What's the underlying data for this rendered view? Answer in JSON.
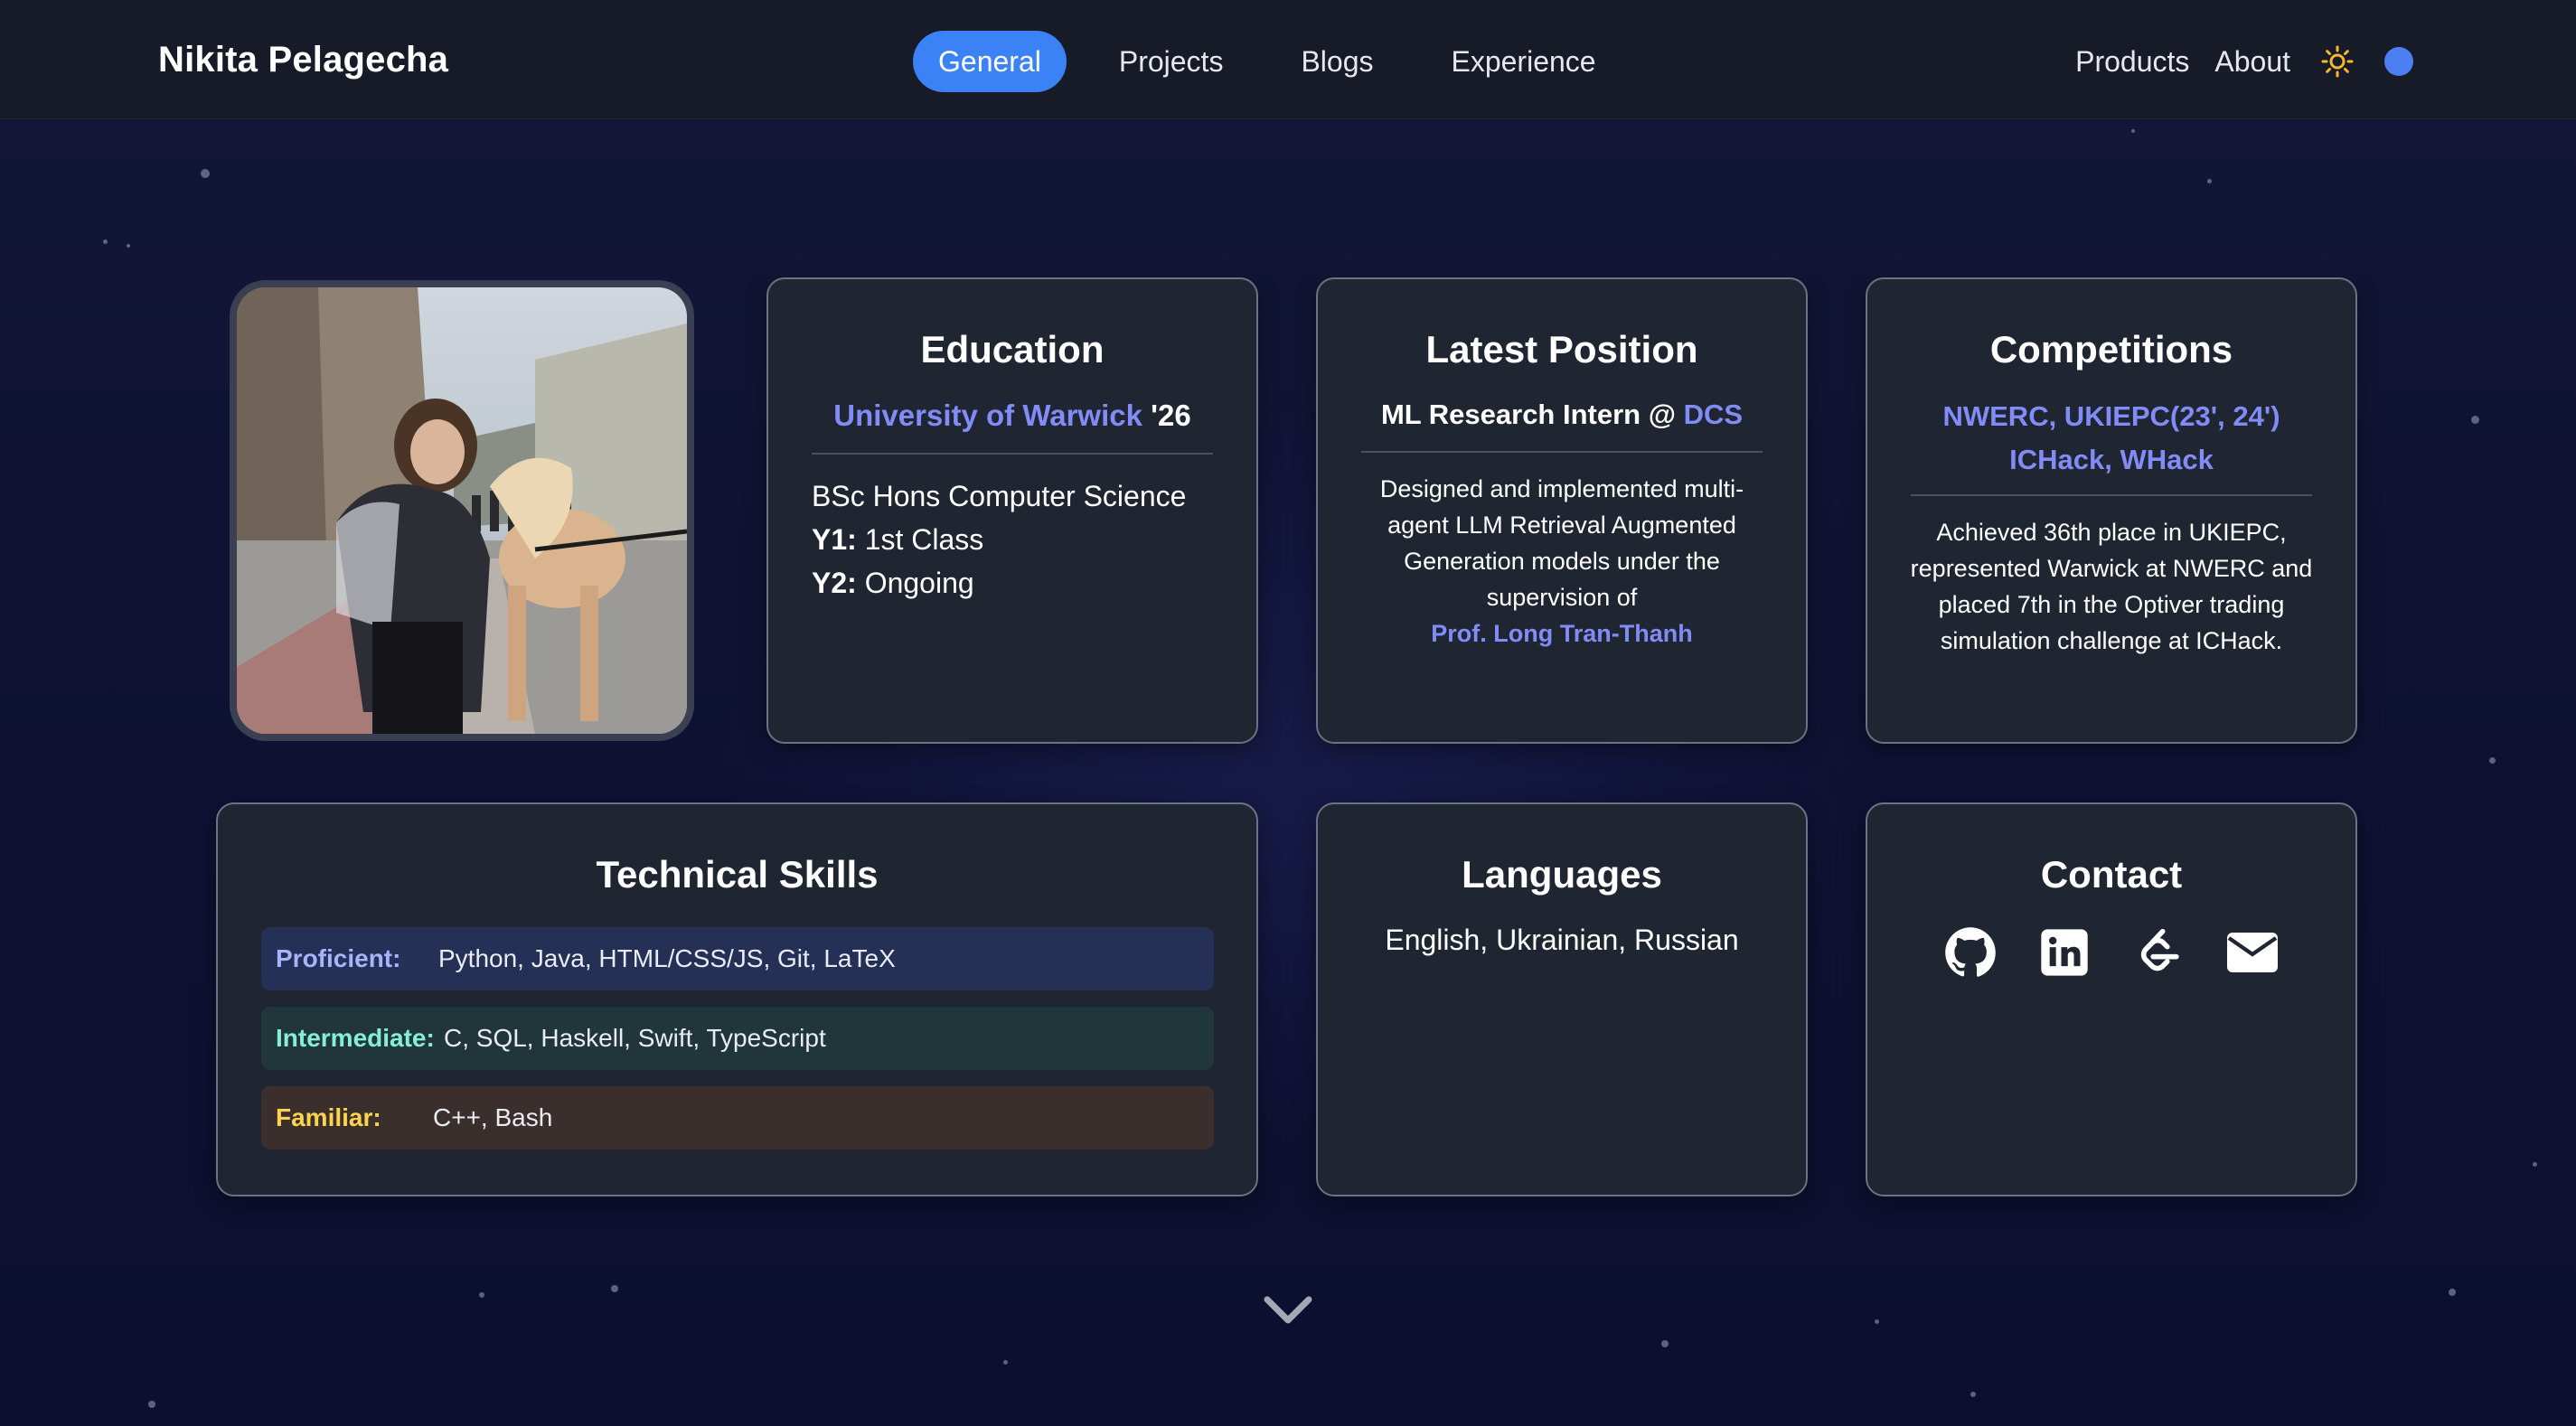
{
  "header": {
    "brand": "Nikita Pelagecha",
    "tabs": [
      {
        "label": "General"
      },
      {
        "label": "Projects"
      },
      {
        "label": "Blogs"
      },
      {
        "label": "Experience"
      }
    ],
    "links": [
      {
        "label": "Products"
      },
      {
        "label": "About"
      }
    ],
    "theme_icon": "sun-icon",
    "toggle_color": "#4b7ff2"
  },
  "profile_photo": {
    "icon": "profile-photo"
  },
  "education": {
    "title": "Education",
    "school": "University of Warwick",
    "year": "'26",
    "degree": "BSc Hons Computer Science",
    "y1_label": "Y1:",
    "y1_value": "1st Class",
    "y2_label": "Y2:",
    "y2_value": "Ongoing"
  },
  "position": {
    "title": "Latest Position",
    "role": "ML Research Intern @",
    "org": "DCS",
    "description": "Designed and implemented multi-agent LLM Retrieval Augmented Generation models under the supervision of",
    "supervisor": "Prof. Long Tran-Thanh"
  },
  "competitions": {
    "title": "Competitions",
    "line1": "NWERC, UKIEPC(23', 24')",
    "line2": "ICHack, WHack",
    "description": "Achieved 36th place in UKIEPC, represented Warwick at NWERC and placed 7th in the Optiver trading simulation challenge at ICHack."
  },
  "skills": {
    "title": "Technical Skills",
    "rows": [
      {
        "label": "Proficient:",
        "value": "Python, Java, HTML/CSS/JS, Git, LaTeX"
      },
      {
        "label": "Intermediate:",
        "value": "C, SQL, Haskell, Swift, TypeScript"
      },
      {
        "label": "Familiar:",
        "value": "C++, Bash"
      }
    ]
  },
  "languages": {
    "title": "Languages",
    "value": "English, Ukrainian, Russian"
  },
  "contact": {
    "title": "Contact",
    "icons": [
      "github-icon",
      "linkedin-icon",
      "leetcode-icon",
      "email-icon"
    ]
  },
  "scroll_icon": "chevron-down-icon",
  "colors": {
    "accent": "#818cf8",
    "active_tab": "#3b82f6",
    "card_bg": "#1f2531",
    "page_bg": "#0f1233"
  }
}
